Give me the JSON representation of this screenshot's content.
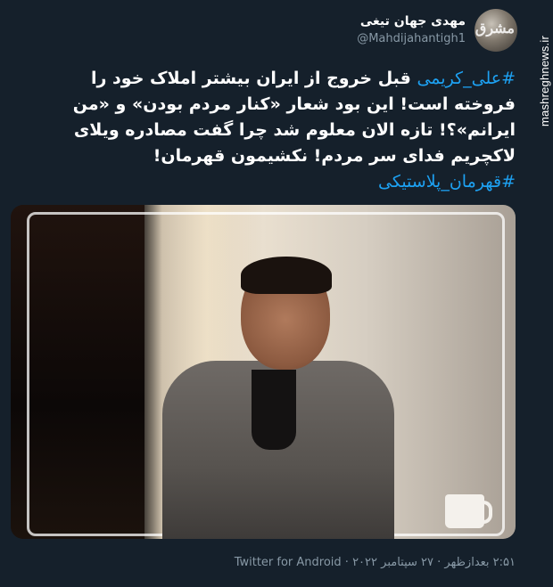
{
  "user": {
    "display_name": "مهدی جهان تیغی",
    "handle": "@Mahdijahantigh1"
  },
  "watermark": "mashreghnews.ir",
  "avatar_stamp": "مشرق",
  "tweet": {
    "hashtag_start": "#علی_کریمی",
    "body": " قبل خروج از ایران بیشتر املاک خود را فروخته است! این بود شعار «کنار مردم بودن» و «من ایرانم»؟! تازه الان معلوم شد چرا گفت مصادره ویلای لاکچریم فدای سر مردم! نکشیمون قهرمان!",
    "hashtag_end": "#قهرمان_پلاستیکی"
  },
  "meta": {
    "time": "۲:۵۱ بعدازظهر",
    "separator1": " · ",
    "date": "۲۷ سپتامبر ۲۰۲۲",
    "separator2": " · ",
    "client": "Twitter for Android"
  },
  "colors": {
    "background": "#15202b",
    "link": "#1da1f2",
    "muted": "#8899a6"
  }
}
